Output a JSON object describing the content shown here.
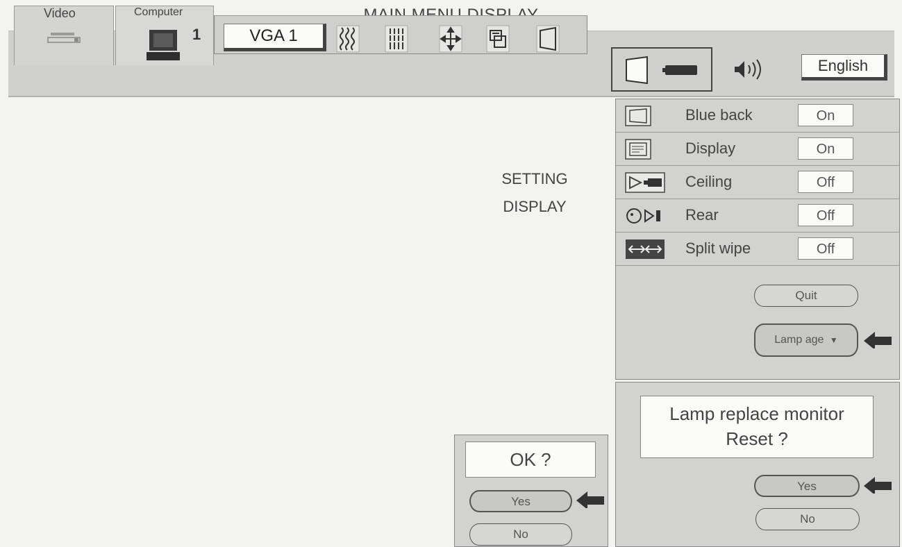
{
  "title": "MAIN MENU DISPLAY",
  "menubar": {
    "video_tab": "Video",
    "computer_tab": "Computer",
    "computer_number": "1",
    "source_input": "VGA 1",
    "language": "English"
  },
  "side_label": [
    "SETTING",
    "DISPLAY"
  ],
  "settings": [
    {
      "label": "Blue back",
      "value": "On"
    },
    {
      "label": "Display",
      "value": "On"
    },
    {
      "label": "Ceiling",
      "value": "Off"
    },
    {
      "label": "Rear",
      "value": "Off"
    },
    {
      "label": "Split wipe",
      "value": "Off"
    }
  ],
  "buttons": {
    "quit": "Quit",
    "lamp_age": "Lamp age"
  },
  "lamp_dialog": {
    "message_line1": "Lamp replace monitor",
    "message_line2": "Reset ?",
    "yes": "Yes",
    "no": "No"
  },
  "ok_dialog": {
    "message": "OK ?",
    "yes": "Yes",
    "no": "No"
  },
  "colors": {
    "panel": "#d2d2d0",
    "page": "#f3f3f1",
    "field": "#fbfbfa",
    "arrow": "#333333"
  }
}
